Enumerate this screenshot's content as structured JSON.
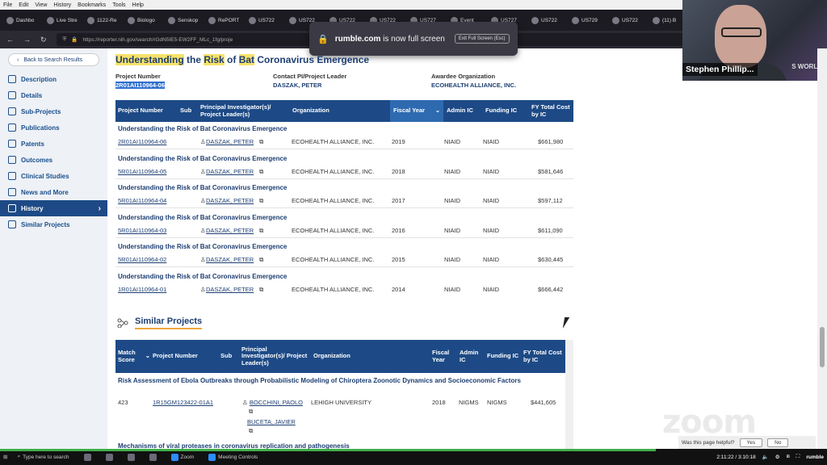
{
  "browser": {
    "menu": [
      "File",
      "Edit",
      "View",
      "History",
      "Bookmarks",
      "Tools",
      "Help"
    ],
    "tabs": [
      "Dashbo",
      "Live Stre",
      "1122-Re",
      "Biologo",
      "Senskop",
      "RePORT",
      "US722",
      "US722",
      "US722",
      "US722",
      "US727",
      "Event",
      "US727",
      "US722",
      "US729",
      "US722",
      "(11) B"
    ],
    "url": "https://reporter.nih.gov/search/rGdN5IE5-EW2FF_MLc_1fg/proje",
    "toast_domain": "rumble.com",
    "toast_text": " is now full screen",
    "toast_exit": "Exit Full Screen (Esc)"
  },
  "webcam": {
    "name": "Stephen Phillip...",
    "bg_text": "S WORLD"
  },
  "sidebar": {
    "back": "Back to Search Results",
    "items": [
      {
        "label": "Description",
        "icon": "gear-icon"
      },
      {
        "label": "Details",
        "icon": "document-icon"
      },
      {
        "label": "Sub-Projects",
        "icon": "hierarchy-icon"
      },
      {
        "label": "Publications",
        "icon": "book-icon"
      },
      {
        "label": "Patents",
        "icon": "lightbulb-icon"
      },
      {
        "label": "Outcomes",
        "icon": "chart-icon"
      },
      {
        "label": "Clinical Studies",
        "icon": "caduceus-icon"
      },
      {
        "label": "News and More",
        "icon": "newspaper-icon"
      },
      {
        "label": "History",
        "icon": "clock-icon",
        "active": true
      },
      {
        "label": "Similar Projects",
        "icon": "network-icon"
      }
    ]
  },
  "project": {
    "title_parts": [
      "Understanding",
      " the ",
      "Risk",
      " of ",
      "Bat",
      " Coronavirus Emergence"
    ],
    "number_label": "Project Number",
    "number": "2R01AI110964-06",
    "pi_label": "Contact PI/Project Leader",
    "pi": "DASZAK, PETER",
    "org_label": "Awardee Organization",
    "org": "ECOHEALTH ALLIANCE, INC."
  },
  "history": {
    "headers": [
      "Project Number",
      "Sub",
      "Principal Investigator(s)/ Project Leader(s)",
      "Organization",
      "Fiscal Year",
      "Admin IC",
      "Funding IC",
      "FY Total Cost by IC"
    ],
    "rows": [
      {
        "title": "Understanding the Risk of Bat Coronavirus Emergence",
        "number": "2R01AI110964-06",
        "pi": "DASZAK, PETER",
        "org": "ECOHEALTH ALLIANCE, INC.",
        "year": "2019",
        "admin": "NIAID",
        "funding": "NIAID",
        "cost": "$661,980"
      },
      {
        "title": "Understanding the Risk of Bat Coronavirus Emergence",
        "number": "5R01AI110964-05",
        "pi": "DASZAK, PETER",
        "org": "ECOHEALTH ALLIANCE, INC.",
        "year": "2018",
        "admin": "NIAID",
        "funding": "NIAID",
        "cost": "$581,646"
      },
      {
        "title": "Understanding the Risk of Bat Coronavirus Emergence",
        "number": "5R01AI110964-04",
        "pi": "DASZAK, PETER",
        "org": "ECOHEALTH ALLIANCE, INC.",
        "year": "2017",
        "admin": "NIAID",
        "funding": "NIAID",
        "cost": "$597,112"
      },
      {
        "title": "Understanding the Risk of Bat Coronavirus Emergence",
        "number": "5R01AI110964-03",
        "pi": "DASZAK, PETER",
        "org": "ECOHEALTH ALLIANCE, INC.",
        "year": "2016",
        "admin": "NIAID",
        "funding": "NIAID",
        "cost": "$611,090"
      },
      {
        "title": "Understanding the Risk of Bat Coronavirus Emergence",
        "number": "5R01AI110964-02",
        "pi": "DASZAK, PETER",
        "org": "ECOHEALTH ALLIANCE, INC.",
        "year": "2015",
        "admin": "NIAID",
        "funding": "NIAID",
        "cost": "$630,445"
      },
      {
        "title": "Understanding the Risk of Bat Coronavirus Emergence",
        "number": "1R01AI110964-01",
        "pi": "DASZAK, PETER",
        "org": "ECOHEALTH ALLIANCE, INC.",
        "year": "2014",
        "admin": "NIAID",
        "funding": "NIAID",
        "cost": "$666,442"
      }
    ]
  },
  "similar": {
    "title": "Similar Projects",
    "headers": [
      "Match Score",
      "Project Number",
      "Sub",
      "Principal Investigator(s)/ Project Leader(s)",
      "Organization",
      "Fiscal Year",
      "Admin IC",
      "Funding IC",
      "FY Total Cost by IC"
    ],
    "row1": {
      "title": "Risk Assessment of Ebola Outbreaks through Probabilistic Modeling of Chiroptera Zoonotic Dynamics and Socioeconomic Factors",
      "score": "423",
      "number": "1R15GM123422-01A1",
      "pi1": "BOCCHINI, PAOLO",
      "pi2": "BUCETA, JAVIER",
      "org": "LEHIGH UNIVERSITY",
      "year": "2018",
      "admin": "NIGMS",
      "funding": "NIGMS",
      "cost": "$441,605"
    },
    "row2_title": "Mechanisms of viral proteases in coronavirus replication and pathogenesis"
  },
  "overlay": {
    "zoom": "zoom",
    "helpful": "Was this page helpful?",
    "yes": "Yes",
    "no": "No"
  },
  "taskbar": {
    "items": [
      "Type here to search",
      "",
      "",
      "",
      "",
      "Zoom",
      "Meeting Controls"
    ],
    "time": "2:11:22 / 3:10:18",
    "brand": "rumble"
  }
}
